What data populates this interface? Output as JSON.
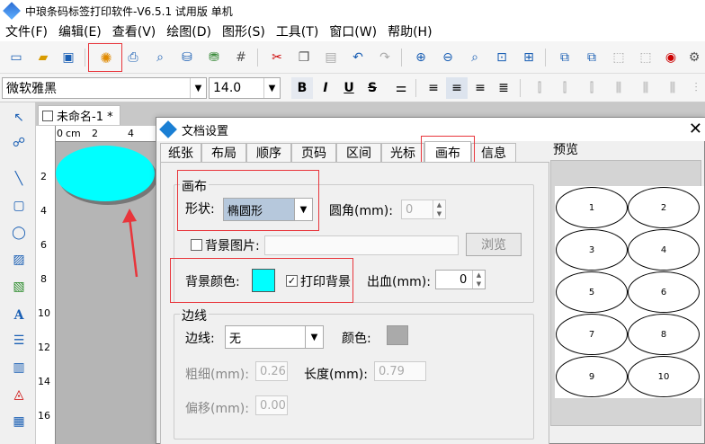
{
  "app": {
    "title": "中琅条码标签打印软件-V6.5.1 试用版 单机"
  },
  "menu": [
    "文件(F)",
    "编辑(E)",
    "查看(V)",
    "绘图(D)",
    "图形(S)",
    "工具(T)",
    "窗口(W)",
    "帮助(H)"
  ],
  "font_toolbar": {
    "font": "微软雅黑",
    "size": "14.0",
    "bold": "B",
    "italic": "I",
    "underline": "U",
    "strike": "S"
  },
  "document": {
    "tab": "未命名-1 *",
    "ruler_unit": "cm",
    "ruler_h_ticks": [
      "0",
      "2",
      "4"
    ],
    "ruler_v_ticks": [
      "2",
      "4",
      "6",
      "8",
      "10",
      "12",
      "14",
      "16"
    ],
    "label_shape_color": "#00ffff"
  },
  "dialog": {
    "title": "文档设置",
    "tabs": [
      "纸张",
      "布局",
      "顺序",
      "页码",
      "区间",
      "光标",
      "画布",
      "信息"
    ],
    "active_tab": "画布",
    "canvas_group": {
      "title": "画布",
      "shape_label": "形状:",
      "shape_value": "椭圆形",
      "corner_label": "圆角(mm):",
      "corner_value": "0",
      "bg_image_label": "背景图片:",
      "browse": "浏览",
      "bg_color_label": "背景颜色:",
      "bg_color": "#00ffff",
      "print_bg_label": "打印背景",
      "print_bg_checked": true,
      "bleed_label": "出血(mm):",
      "bleed_value": "0"
    },
    "border_group": {
      "title": "边线",
      "border_label": "边线:",
      "border_value": "无",
      "color_label": "颜色:",
      "thickness_label": "粗细(mm):",
      "thickness_value": "0.26",
      "length_label": "长度(mm):",
      "length_value": "0.79",
      "offset_label": "偏移(mm):",
      "offset_value": "0.00"
    },
    "preview": {
      "title": "预览",
      "labels": [
        "1",
        "2",
        "3",
        "4",
        "5",
        "6",
        "7",
        "8",
        "9",
        "10"
      ]
    }
  },
  "colors": {
    "highlight": "#e8353b",
    "accent": "#1a5fb4"
  }
}
